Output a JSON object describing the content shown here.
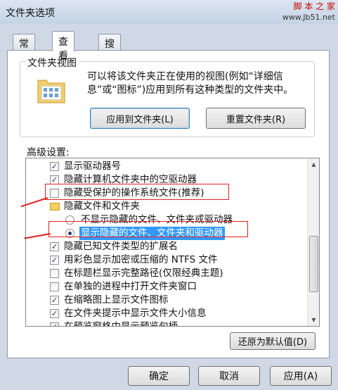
{
  "window": {
    "title": "文件夹选项"
  },
  "watermark": {
    "top_text": "脚 本 之 家",
    "top_url": "www.Jb51.net",
    "bottom_text": ""
  },
  "tabs": [
    {
      "label": "常规",
      "active": false
    },
    {
      "label": "查看",
      "active": true
    },
    {
      "label": "搜索",
      "active": false
    }
  ],
  "folder_views": {
    "title": "文件夹视图",
    "description": "可以将该文件夹正在使用的视图(例如“详细信息”或“图标”)应用到所有这种类型的文件夹中。",
    "apply_button": "应用到文件夹(L)",
    "reset_button": "重置文件夹(R)"
  },
  "advanced": {
    "label": "高级设置:",
    "items": [
      {
        "type": "checkbox",
        "checked": true,
        "label": "显示驱动器号",
        "indent": 1
      },
      {
        "type": "checkbox",
        "checked": true,
        "label": "隐藏计算机文件夹中的空驱动器",
        "indent": 1
      },
      {
        "type": "checkbox",
        "checked": false,
        "label": "隐藏受保护的操作系统文件(推荐)",
        "indent": 1
      },
      {
        "type": "folder",
        "label": "隐藏文件和文件夹",
        "indent": 1
      },
      {
        "type": "radio",
        "checked": false,
        "label": "不显示隐藏的文件、文件夹或驱动器",
        "indent": 2
      },
      {
        "type": "radio",
        "checked": true,
        "label": "显示隐藏的文件、文件夹和驱动器",
        "indent": 2,
        "selected": true
      },
      {
        "type": "checkbox",
        "checked": true,
        "label": "隐藏已知文件类型的扩展名",
        "indent": 1
      },
      {
        "type": "checkbox",
        "checked": true,
        "label": "用彩色显示加密或压缩的 NTFS 文件",
        "indent": 1
      },
      {
        "type": "checkbox",
        "checked": false,
        "label": "在标题栏显示完整路径(仅限经典主题)",
        "indent": 1
      },
      {
        "type": "checkbox",
        "checked": false,
        "label": "在单独的进程中打开文件夹窗口",
        "indent": 1
      },
      {
        "type": "checkbox",
        "checked": true,
        "label": "在缩略图上显示文件图标",
        "indent": 1
      },
      {
        "type": "checkbox",
        "checked": true,
        "label": "在文件夹提示中显示文件大小信息",
        "indent": 1
      },
      {
        "type": "checkbox",
        "checked": true,
        "label": "在预览窗格中显示预览句柄",
        "indent": 1
      }
    ],
    "restore_button": "还原为默认值(D)"
  },
  "footer": {
    "ok": "确定",
    "cancel": "取消",
    "apply": "应用(A)"
  },
  "colors": {
    "selection": "#3399ff",
    "annotation": "#e02020",
    "check": "#1c3f7a"
  }
}
